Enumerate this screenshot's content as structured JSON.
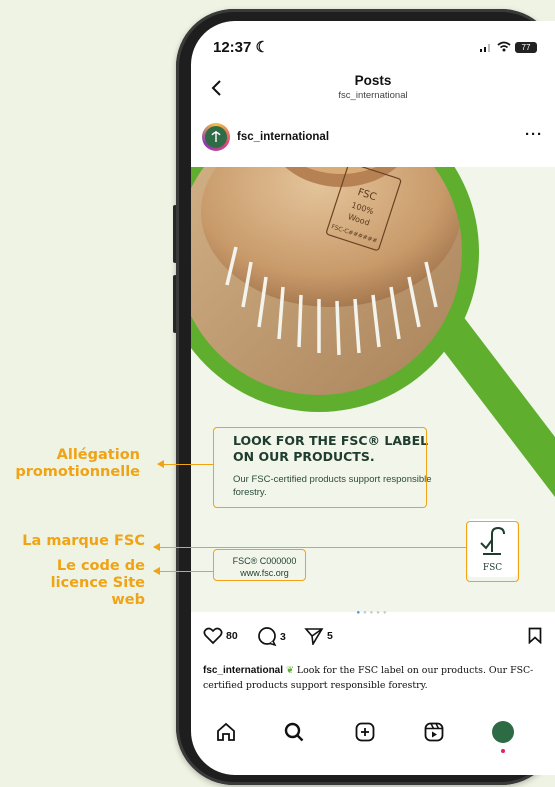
{
  "status_bar": {
    "time": "12:37",
    "battery": "77"
  },
  "nav": {
    "title": "Posts",
    "subtitle": "fsc_international"
  },
  "post": {
    "username": "fsc_international",
    "image": {
      "stamp_text": [
        "FSC",
        "100%",
        "Wood",
        "FSC-C######"
      ],
      "claim_title": "LOOK FOR THE FSC® LABEL ON OUR PRODUCTS.",
      "claim_body": "Our FSC-certified products support responsible forestry.",
      "fsc_logo_text": "FSC",
      "license_code": "FSC® C000000",
      "website": "www.fsc.org"
    },
    "likes": "80",
    "comments": "3",
    "shares": "5",
    "caption_user": "fsc_international",
    "caption_text": "Look for the FSC label on our products. Our FSC-certified products support responsible forestry."
  },
  "annotations": {
    "claim": "Allégation promotionnelle",
    "brand": "La marque FSC",
    "license": "Le code de licence Site web"
  },
  "colors": {
    "annotation": "#f0a314",
    "fsc_green": "#5fae2e",
    "text_dark": "#1f3d2f"
  },
  "tabs": [
    "home-icon",
    "search-icon",
    "create-icon",
    "reels-icon",
    "profile-avatar"
  ]
}
